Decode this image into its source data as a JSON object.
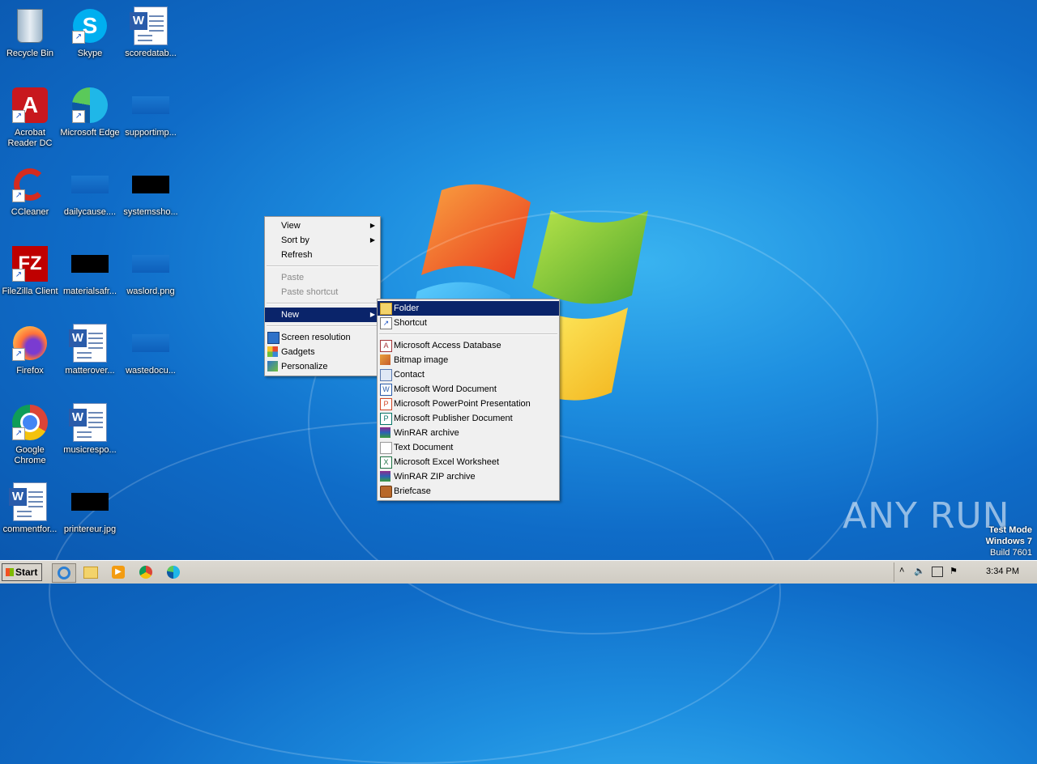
{
  "desktop_icons": [
    {
      "label": "Recycle Bin",
      "icon": "recycle-bin-icon"
    },
    {
      "label": "Skype",
      "icon": "skype-icon"
    },
    {
      "label": "scoredatab...",
      "icon": "word-document-icon"
    },
    {
      "label": "Acrobat Reader DC",
      "icon": "acrobat-icon"
    },
    {
      "label": "Microsoft Edge",
      "icon": "edge-icon"
    },
    {
      "label": "supportimp...",
      "icon": "image-file-icon"
    },
    {
      "label": "CCleaner",
      "icon": "ccleaner-icon"
    },
    {
      "label": "dailycause....",
      "icon": "image-file-icon"
    },
    {
      "label": "systemssho...",
      "icon": "image-file-icon"
    },
    {
      "label": "FileZilla Client",
      "icon": "filezilla-icon"
    },
    {
      "label": "materialsafr...",
      "icon": "image-file-icon"
    },
    {
      "label": "waslord.png",
      "icon": "image-file-icon"
    },
    {
      "label": "Firefox",
      "icon": "firefox-icon"
    },
    {
      "label": "matterover...",
      "icon": "word-document-icon"
    },
    {
      "label": "wastedocu...",
      "icon": "image-file-icon"
    },
    {
      "label": "Google Chrome",
      "icon": "chrome-icon"
    },
    {
      "label": "musicrespo...",
      "icon": "word-document-icon"
    },
    {
      "label": "commentfor...",
      "icon": "word-document-icon"
    },
    {
      "label": "printereur.jpg",
      "icon": "image-file-icon"
    }
  ],
  "context_menu": {
    "view": "View",
    "sort_by": "Sort by",
    "refresh": "Refresh",
    "paste": "Paste",
    "paste_shortcut": "Paste shortcut",
    "new": "New",
    "screen_resolution": "Screen resolution",
    "gadgets": "Gadgets",
    "personalize": "Personalize"
  },
  "new_submenu": {
    "folder": "Folder",
    "shortcut": "Shortcut",
    "items": [
      {
        "label": "Microsoft Access Database",
        "icon": "access-icon"
      },
      {
        "label": "Bitmap image",
        "icon": "bitmap-icon"
      },
      {
        "label": "Contact",
        "icon": "contact-icon"
      },
      {
        "label": "Microsoft Word Document",
        "icon": "word-icon"
      },
      {
        "label": "Microsoft PowerPoint Presentation",
        "icon": "powerpoint-icon"
      },
      {
        "label": "Microsoft Publisher Document",
        "icon": "publisher-icon"
      },
      {
        "label": "WinRAR archive",
        "icon": "winrar-icon"
      },
      {
        "label": "Text Document",
        "icon": "text-document-icon"
      },
      {
        "label": "Microsoft Excel Worksheet",
        "icon": "excel-icon"
      },
      {
        "label": "WinRAR ZIP archive",
        "icon": "winrar-zip-icon"
      },
      {
        "label": "Briefcase",
        "icon": "briefcase-icon"
      }
    ]
  },
  "taskbar": {
    "start_label": "Start",
    "clock": "3:34 PM"
  },
  "watermark": {
    "line1": "Test Mode",
    "line2": "Windows 7",
    "line3": "Build 7601",
    "brand": "ANY RUN"
  }
}
